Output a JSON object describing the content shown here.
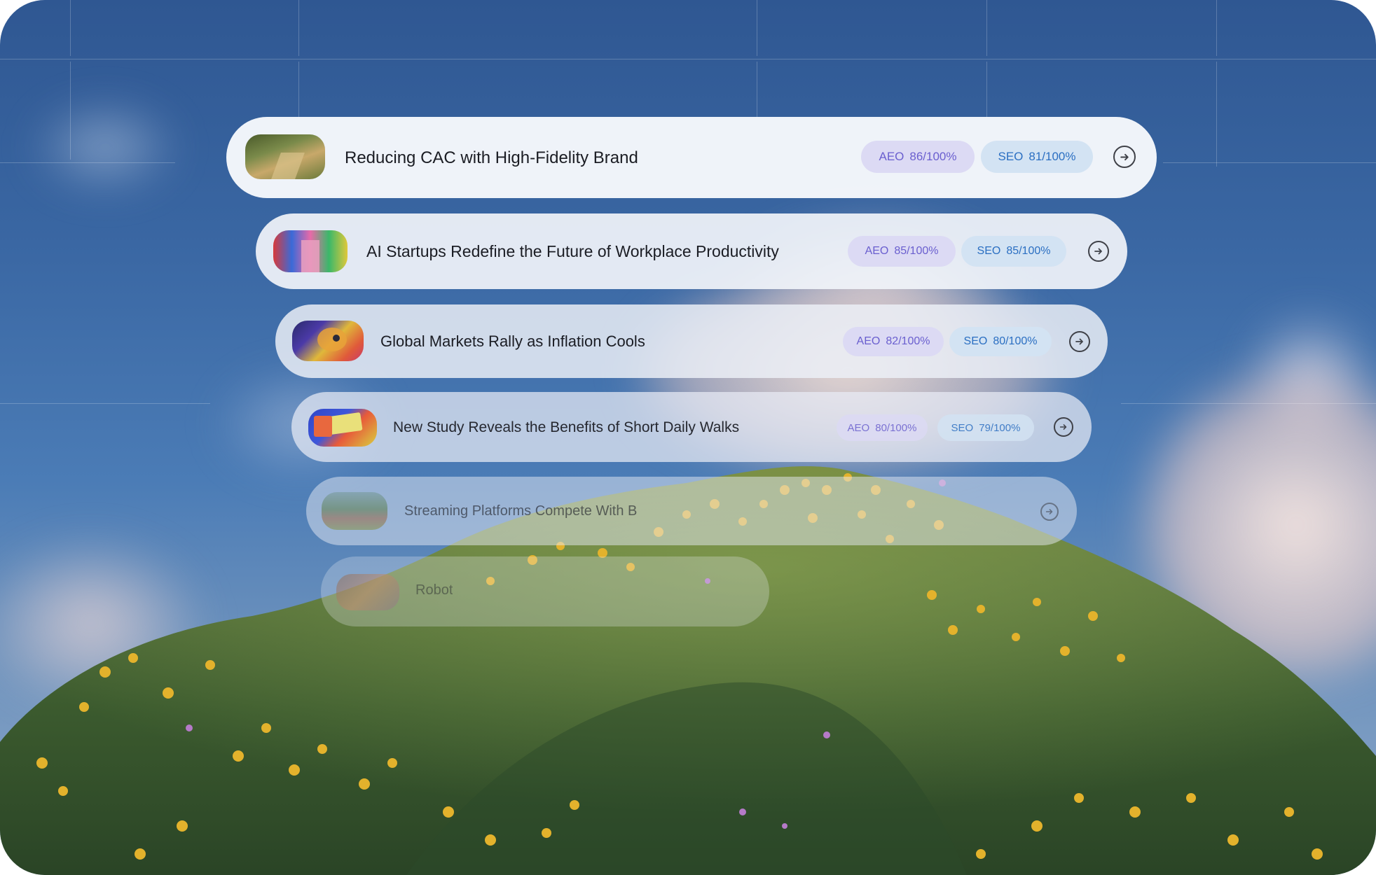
{
  "colors": {
    "aeo_text": "#6a5fcf",
    "aeo_bg": "#dcdaf4",
    "seo_text": "#2b6fc2",
    "seo_bg": "#d3e3f3",
    "title_text": "#1b1d24",
    "sky_top": "#2f5792",
    "grass": "#3f5a2a",
    "flowers": "#e3b22c"
  },
  "articles": [
    {
      "title": "Reducing CAC with High-Fidelity Brand",
      "aeo_label": "AEO",
      "aeo_value": "86/100%",
      "seo_label": "SEO",
      "seo_value": "81/100%",
      "action_icon": "arrow-right-circle-icon"
    },
    {
      "title": "AI Startups Redefine the Future of Workplace Productivity",
      "aeo_label": "AEO",
      "aeo_value": "85/100%",
      "seo_label": "SEO",
      "seo_value": "85/100%",
      "action_icon": "arrow-right-circle-icon"
    },
    {
      "title": "Global Markets Rally as Inflation Cools",
      "aeo_label": "AEO",
      "aeo_value": "82/100%",
      "seo_label": "SEO",
      "seo_value": "80/100%",
      "action_icon": "arrow-right-circle-icon"
    },
    {
      "title": "New Study Reveals the Benefits of Short Daily Walks",
      "aeo_label": "AEO",
      "aeo_value": "80/100%",
      "seo_label": "SEO",
      "seo_value": "79/100%",
      "action_icon": "arrow-right-circle-icon"
    },
    {
      "title": "Streaming Platforms Compete With B",
      "action_icon": "arrow-right-circle-icon"
    },
    {
      "title": "Robot"
    }
  ]
}
